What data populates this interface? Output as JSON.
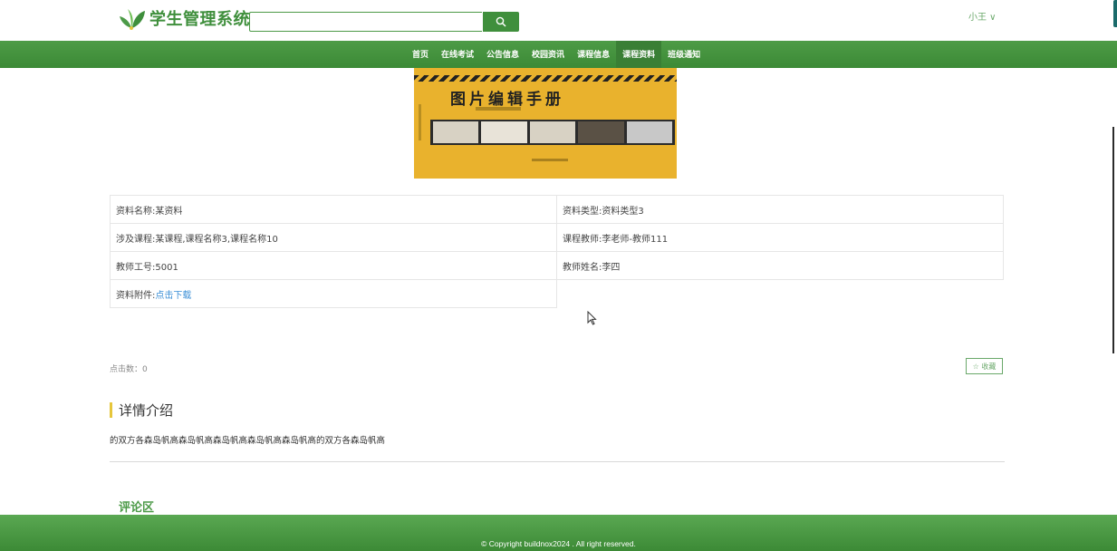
{
  "header": {
    "logo_text": "学生管理系统",
    "search_placeholder": "",
    "user_name": "小王 ∨"
  },
  "nav": {
    "items": [
      "首页",
      "在线考试",
      "公告信息",
      "校园资讯",
      "课程信息",
      "课程资料",
      "班级通知"
    ],
    "active_index": 5
  },
  "book_cover": {
    "title": "图片编辑手册"
  },
  "info": {
    "name": "资料名称:某资料",
    "type": "资料类型:资料类型3",
    "course": "涉及课程:某课程,课程名称3,课程名称10",
    "teacher": "课程教师:李老师-教师111",
    "teacher_id": "教师工号:5001",
    "teacher_name": "教师姓名:李四",
    "attachment_label": "资料附件:",
    "attachment_link": "点击下载"
  },
  "stats": {
    "clicks": "点击数：0"
  },
  "favorite_button": "☆ 收藏",
  "detail": {
    "title": "详情介绍",
    "text": "的双方各森岛帆高森岛帆高森岛帆高森岛帆高森岛帆高的双方各森岛帆高"
  },
  "comments": {
    "title": "评论区"
  },
  "footer": {
    "copyright": "© Copyright buildnox2024 . All right reserved."
  },
  "colors": {
    "primary_green": "#3f8f3c",
    "accent_yellow": "#e6c63b",
    "link_blue": "#3b8fd6"
  }
}
